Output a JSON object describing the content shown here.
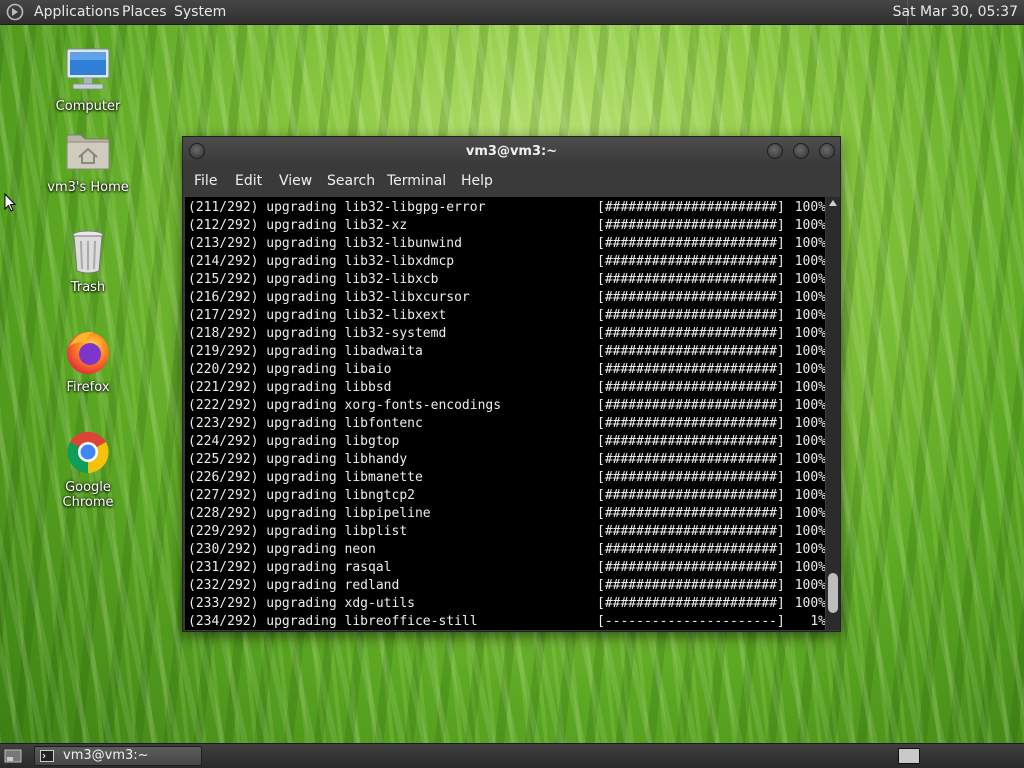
{
  "top_panel": {
    "menus": [
      "Applications",
      "Places",
      "System"
    ],
    "clock": "Sat Mar 30, 05:37"
  },
  "desktop_icons": [
    {
      "label": "Computer",
      "icon": "computer-icon"
    },
    {
      "label": "vm3's Home",
      "icon": "home-folder-icon"
    },
    {
      "label": "Trash",
      "icon": "trash-icon"
    },
    {
      "label": "Firefox",
      "icon": "firefox-icon"
    },
    {
      "label": "Google Chrome",
      "icon": "chrome-icon"
    }
  ],
  "window": {
    "title": "vm3@vm3:~",
    "menu": [
      "File",
      "Edit",
      "View",
      "Search",
      "Terminal",
      "Help"
    ]
  },
  "terminal": {
    "lines": [
      {
        "text": "(211/292) upgrading lib32-libgpg-error",
        "bar": "[######################]",
        "pct": "100%"
      },
      {
        "text": "(212/292) upgrading lib32-xz",
        "bar": "[######################]",
        "pct": "100%"
      },
      {
        "text": "(213/292) upgrading lib32-libunwind",
        "bar": "[######################]",
        "pct": "100%"
      },
      {
        "text": "(214/292) upgrading lib32-libxdmcp",
        "bar": "[######################]",
        "pct": "100%"
      },
      {
        "text": "(215/292) upgrading lib32-libxcb",
        "bar": "[######################]",
        "pct": "100%"
      },
      {
        "text": "(216/292) upgrading lib32-libxcursor",
        "bar": "[######################]",
        "pct": "100%"
      },
      {
        "text": "(217/292) upgrading lib32-libxext",
        "bar": "[######################]",
        "pct": "100%"
      },
      {
        "text": "(218/292) upgrading lib32-systemd",
        "bar": "[######################]",
        "pct": "100%"
      },
      {
        "text": "(219/292) upgrading libadwaita",
        "bar": "[######################]",
        "pct": "100%"
      },
      {
        "text": "(220/292) upgrading libaio",
        "bar": "[######################]",
        "pct": "100%"
      },
      {
        "text": "(221/292) upgrading libbsd",
        "bar": "[######################]",
        "pct": "100%"
      },
      {
        "text": "(222/292) upgrading xorg-fonts-encodings",
        "bar": "[######################]",
        "pct": "100%"
      },
      {
        "text": "(223/292) upgrading libfontenc",
        "bar": "[######################]",
        "pct": "100%"
      },
      {
        "text": "(224/292) upgrading libgtop",
        "bar": "[######################]",
        "pct": "100%"
      },
      {
        "text": "(225/292) upgrading libhandy",
        "bar": "[######################]",
        "pct": "100%"
      },
      {
        "text": "(226/292) upgrading libmanette",
        "bar": "[######################]",
        "pct": "100%"
      },
      {
        "text": "(227/292) upgrading libngtcp2",
        "bar": "[######################]",
        "pct": "100%"
      },
      {
        "text": "(228/292) upgrading libpipeline",
        "bar": "[######################]",
        "pct": "100%"
      },
      {
        "text": "(229/292) upgrading libplist",
        "bar": "[######################]",
        "pct": "100%"
      },
      {
        "text": "(230/292) upgrading neon",
        "bar": "[######################]",
        "pct": "100%"
      },
      {
        "text": "(231/292) upgrading rasqal",
        "bar": "[######################]",
        "pct": "100%"
      },
      {
        "text": "(232/292) upgrading redland",
        "bar": "[######################]",
        "pct": "100%"
      },
      {
        "text": "(233/292) upgrading xdg-utils",
        "bar": "[######################]",
        "pct": "100%"
      },
      {
        "text": "(234/292) upgrading libreoffice-still",
        "bar": "[----------------------]",
        "pct": "1%"
      }
    ]
  },
  "taskbar": {
    "task_label": "vm3@vm3:~"
  }
}
